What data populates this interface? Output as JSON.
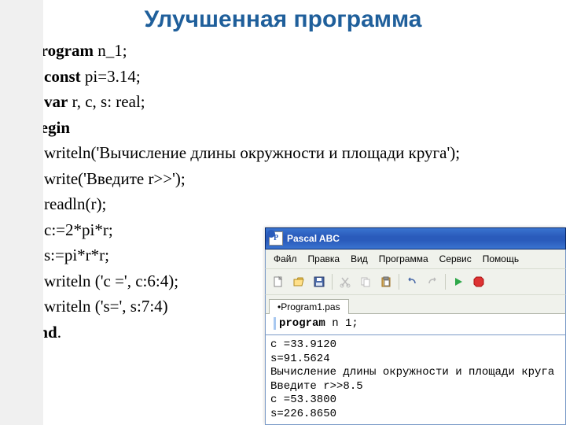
{
  "title": "Улучшенная программа",
  "code": {
    "l1a": "program",
    "l1b": " n_1;",
    "l2a": "const",
    "l2b": " pi=3.14;",
    "l3a": "var",
    "l3b": " r, c, s: real;",
    "l4": "begin",
    "l5": "writeln('Вычисление длины окружности и площади круга');",
    "l6": "write('Введите r>>');",
    "l7": "readln(r);",
    "l8": "c:=2*pi*r;",
    "l9": "s:=pi*r*r;",
    "l10": "writeln ('c =', с:6:4);",
    "l11": "writeln ('s=', s:7:4)",
    "l12a": "end",
    "l12b": "."
  },
  "app": {
    "title": "Pascal ABC",
    "iconLetter": "P",
    "menu": [
      "Файл",
      "Правка",
      "Вид",
      "Программа",
      "Сервис",
      "Помощь"
    ],
    "tab": "•Program1.pas",
    "editor_kw": "program",
    "editor_rest": " n 1;",
    "output": "c =33.9120\ns=91.5624\nВычисление длины окружности и площади круга\nВведите r>>8.5\nc =53.3800\ns=226.8650"
  }
}
